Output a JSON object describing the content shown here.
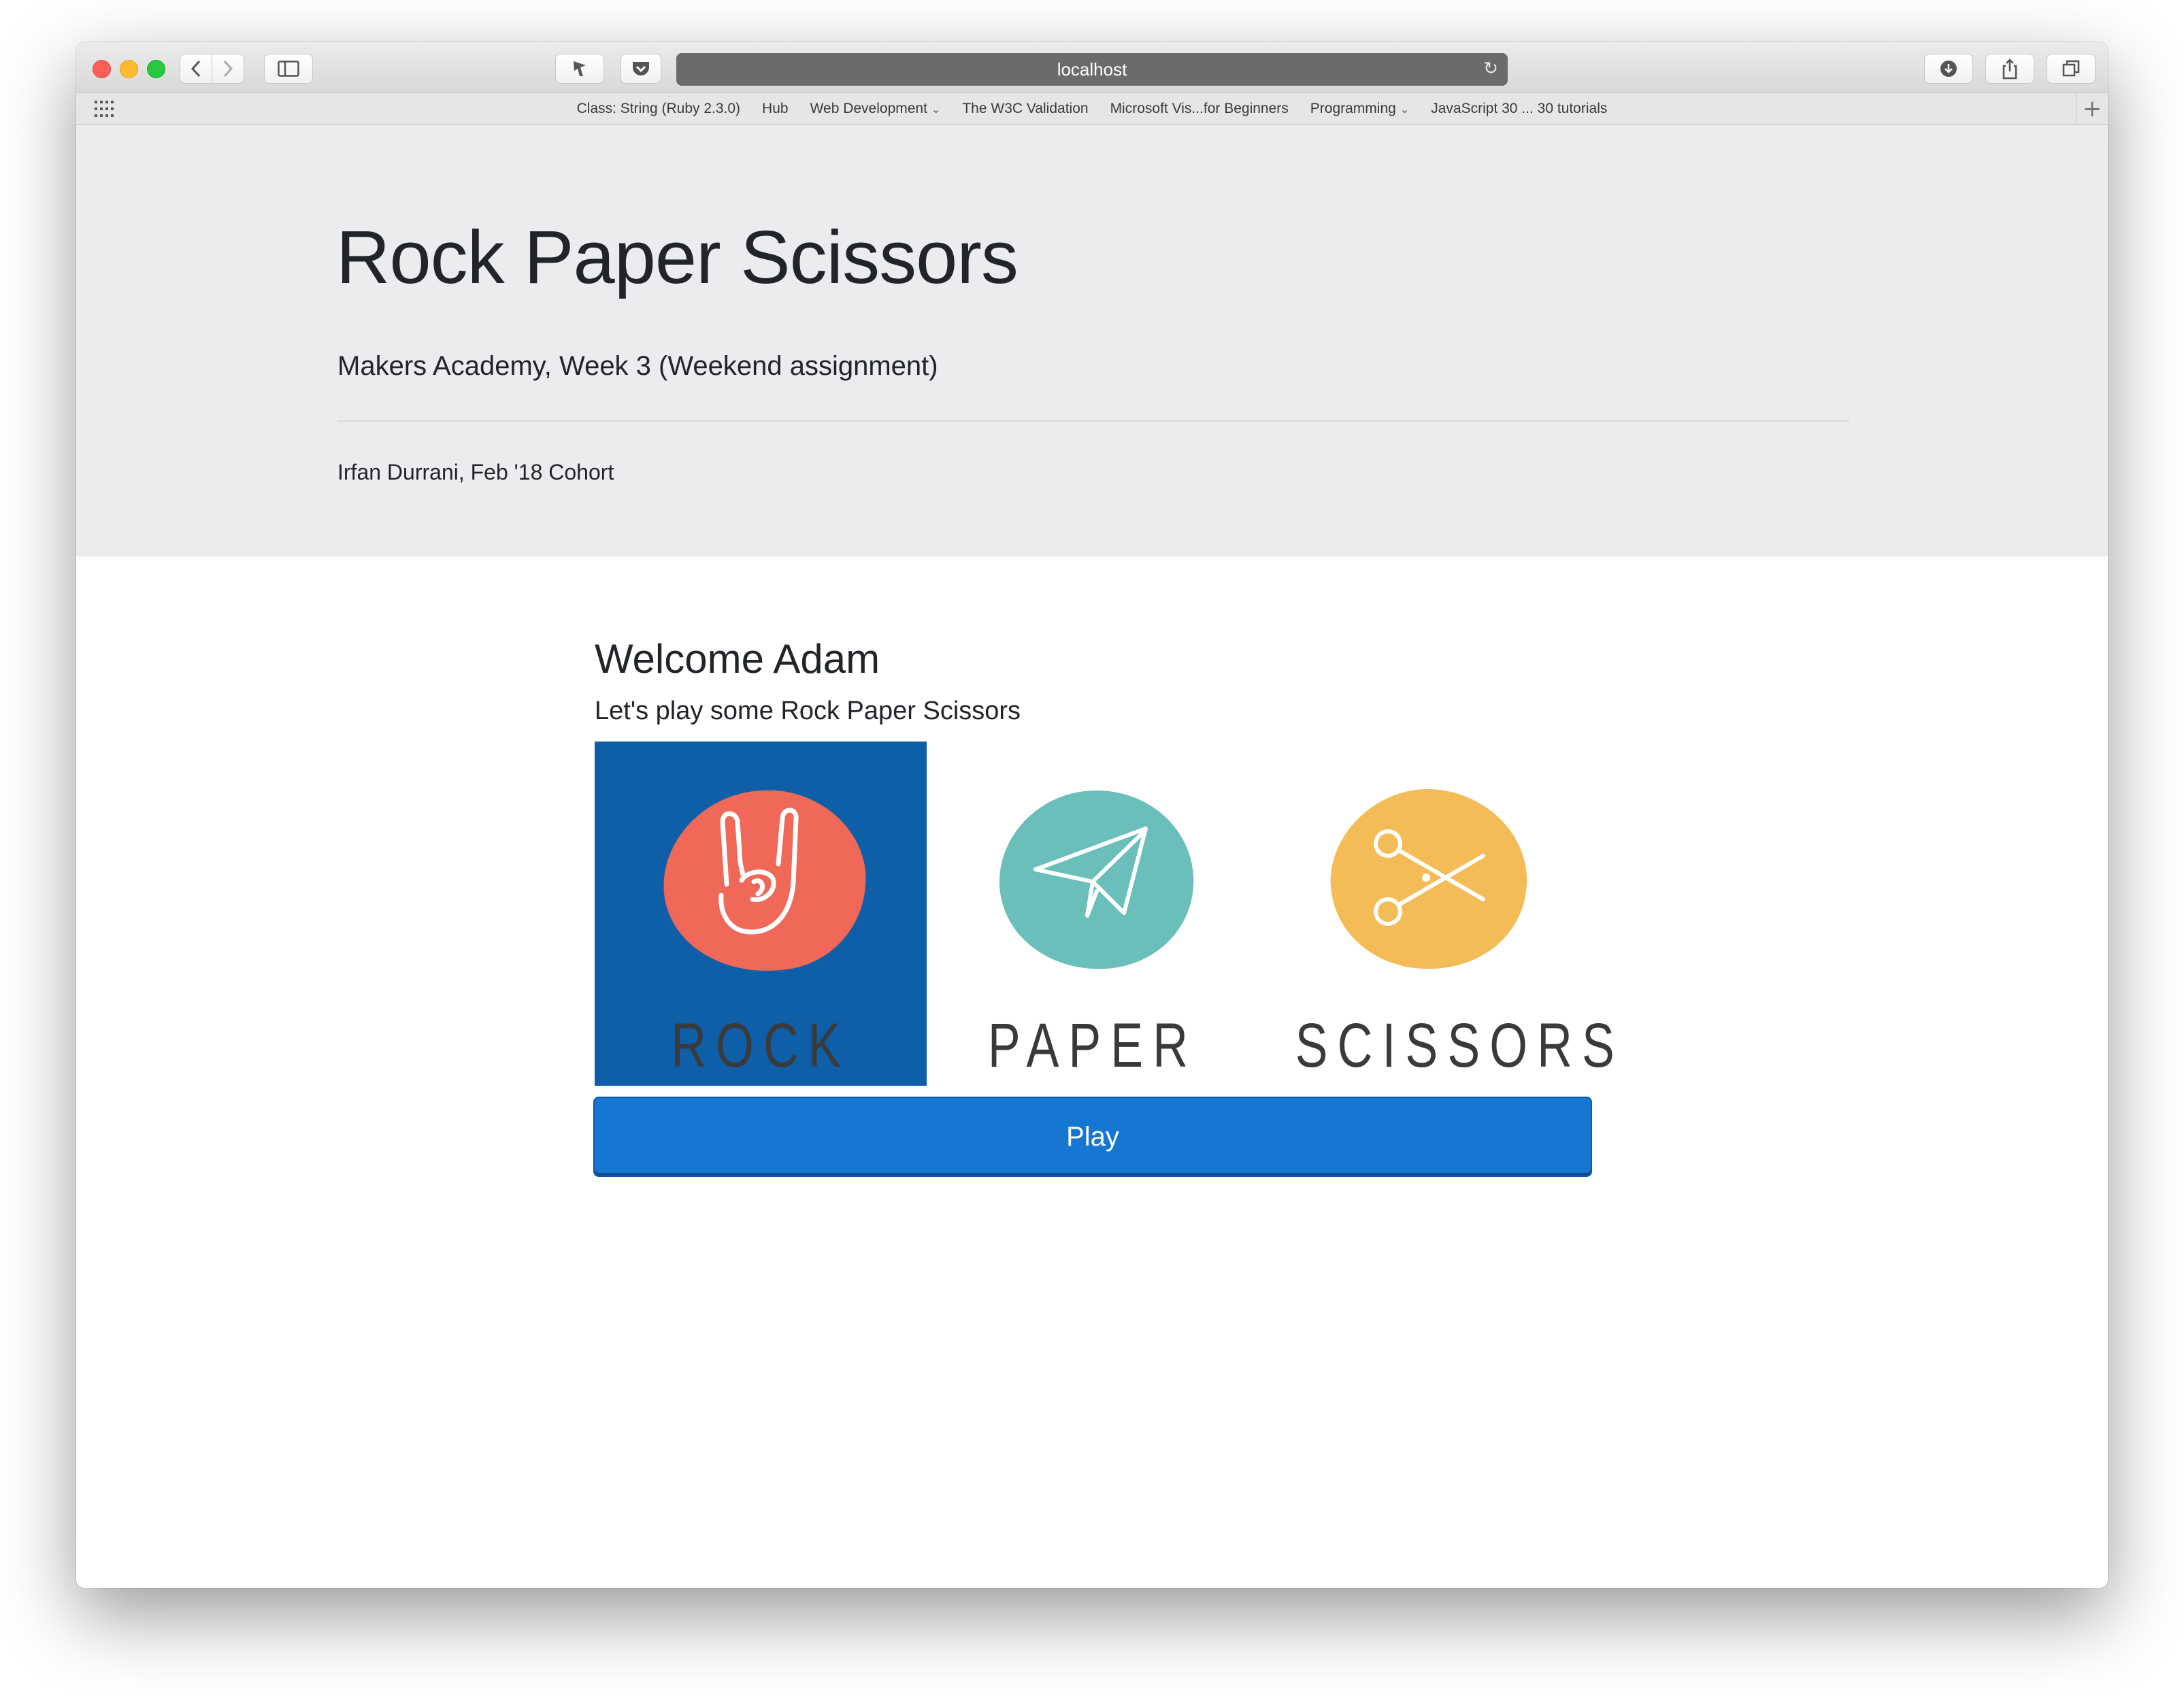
{
  "browser": {
    "url": "localhost",
    "bookmarks": [
      {
        "label": "Class: String (Ruby 2.3.0)",
        "has_menu": false
      },
      {
        "label": "Hub",
        "has_menu": false
      },
      {
        "label": "Web Development",
        "has_menu": true
      },
      {
        "label": "The W3C Validation",
        "has_menu": false
      },
      {
        "label": "Microsoft Vis...for Beginners",
        "has_menu": false
      },
      {
        "label": "Programming",
        "has_menu": true
      },
      {
        "label": "JavaScript 30 ... 30 tutorials",
        "has_menu": false
      }
    ]
  },
  "jumbotron": {
    "title": "Rock Paper Scissors",
    "lead": "Makers Academy, Week 3 (Weekend assignment)",
    "author": "Irfan Durrani, Feb '18 Cohort"
  },
  "game": {
    "welcome": "Welcome Adam",
    "subheading": "Let's play some Rock Paper Scissors",
    "choices": [
      {
        "label": "ROCK",
        "icon": "rock-hand-icon",
        "color": "#ef6858",
        "selected": true
      },
      {
        "label": "PAPER",
        "icon": "paper-plane-icon",
        "color": "#6abfba",
        "selected": false
      },
      {
        "label": "SCISSORS",
        "icon": "scissors-icon",
        "color": "#f4bc57",
        "selected": false
      }
    ],
    "play_label": "Play"
  },
  "colors": {
    "selected_background": "#0e5ea8",
    "play_button": "#1677d2",
    "jumbotron_background": "#ececee"
  }
}
